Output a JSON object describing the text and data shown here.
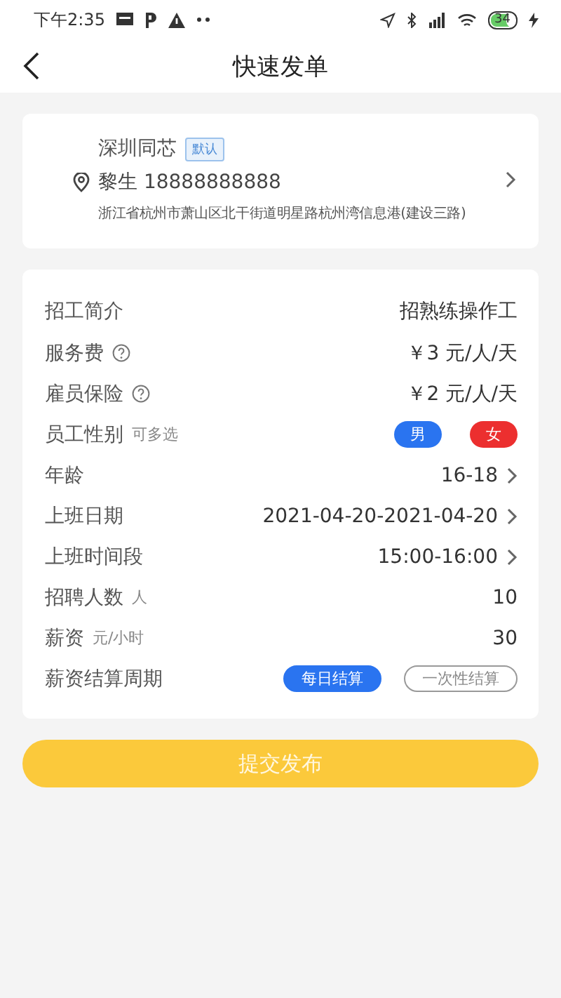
{
  "status_bar": {
    "time": "下午2:35",
    "battery": "34"
  },
  "nav": {
    "title": "快速发单"
  },
  "address": {
    "company": "深圳同芯",
    "tag": "默认",
    "contact": "黎生 18888888888",
    "detail": "浙江省杭州市萧山区北干街道明星路杭州湾信息港(建设三路)"
  },
  "rows": [
    {
      "kind": "text",
      "label": "招工简介",
      "value": "招熟练操作工"
    },
    {
      "kind": "help",
      "label": "服务费",
      "value": "￥3 元/人/天"
    },
    {
      "kind": "help",
      "label": "雇员保险",
      "value": "￥2 元/人/天"
    },
    {
      "kind": "chips",
      "label": "员工性别",
      "hint": "可多选",
      "options": [
        {
          "label": "男",
          "selected": true,
          "color": "#2a74f0"
        },
        {
          "label": "女",
          "selected": true,
          "color": "#ec2f2f"
        }
      ]
    },
    {
      "kind": "link",
      "label": "年龄",
      "value": "16-18"
    },
    {
      "kind": "link",
      "label": "上班日期",
      "value": "2021-04-20-2021-04-20"
    },
    {
      "kind": "link",
      "label": "上班时间段",
      "value": "15:00-16:00"
    },
    {
      "kind": "text",
      "label": "招聘人数",
      "hint": "人",
      "value": "10"
    },
    {
      "kind": "text",
      "label": "薪资",
      "hint": "元/小时",
      "value": "30"
    },
    {
      "kind": "choice",
      "label": "薪资结算周期",
      "options": [
        {
          "label": "每日结算",
          "selected": true
        },
        {
          "label": "一次性结算",
          "selected": false
        }
      ]
    }
  ],
  "submit": {
    "label": "提交发布"
  }
}
